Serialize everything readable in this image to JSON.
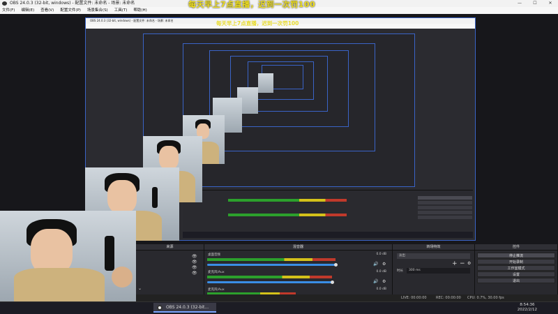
{
  "window": {
    "title": "OBS 24.0.3 (32-bit, windows) - 配置文件: 未命名 - 场景: 未命名"
  },
  "menu": [
    "文件(F)",
    "编辑(E)",
    "查看(V)",
    "配置文件(P)",
    "场景集合(S)",
    "工具(T)",
    "帮助(H)"
  ],
  "overlay": {
    "main": "每天早上7点直播，迟到一次罚100",
    "echo": "每天早上7点直播，迟到一次罚100"
  },
  "inner": {
    "title": "OBS 24.0.3 (32-bit, windows) - 配置文件: 未命名 - 场景: 未命名"
  },
  "docks": {
    "scenes": "来源",
    "mixer": "混音器",
    "transitions": "转场特效",
    "controls": "控件"
  },
  "mixer": {
    "ch1": {
      "name": "桌面音频",
      "db": "0.0 dB",
      "level": 0.8
    },
    "ch2": {
      "name": "麦克风/Aux",
      "db": "0.0 dB",
      "level": 0.78
    },
    "ch3": {
      "name": "麦克风/Aux",
      "db": "0.0 dB",
      "level": 0.55
    }
  },
  "transitions": {
    "type": "淡出",
    "duration_label": "时长",
    "duration": "300 ms"
  },
  "controls": [
    "停止推流",
    "开始录制",
    "工作室模式",
    "设置",
    "退出"
  ],
  "status": {
    "live": "LIVE: 00:00:00",
    "rec": "REC: 00:00:00",
    "cpu": "CPU: 0.7%, 30.00 fps"
  },
  "taskbar": {
    "app": "OBS 24.0.3 (32-bit...",
    "time": "8:54:36",
    "date": "2022/2/12"
  },
  "colors": {
    "accent": "#3a64c8",
    "overlay_text": "#f0e020"
  }
}
